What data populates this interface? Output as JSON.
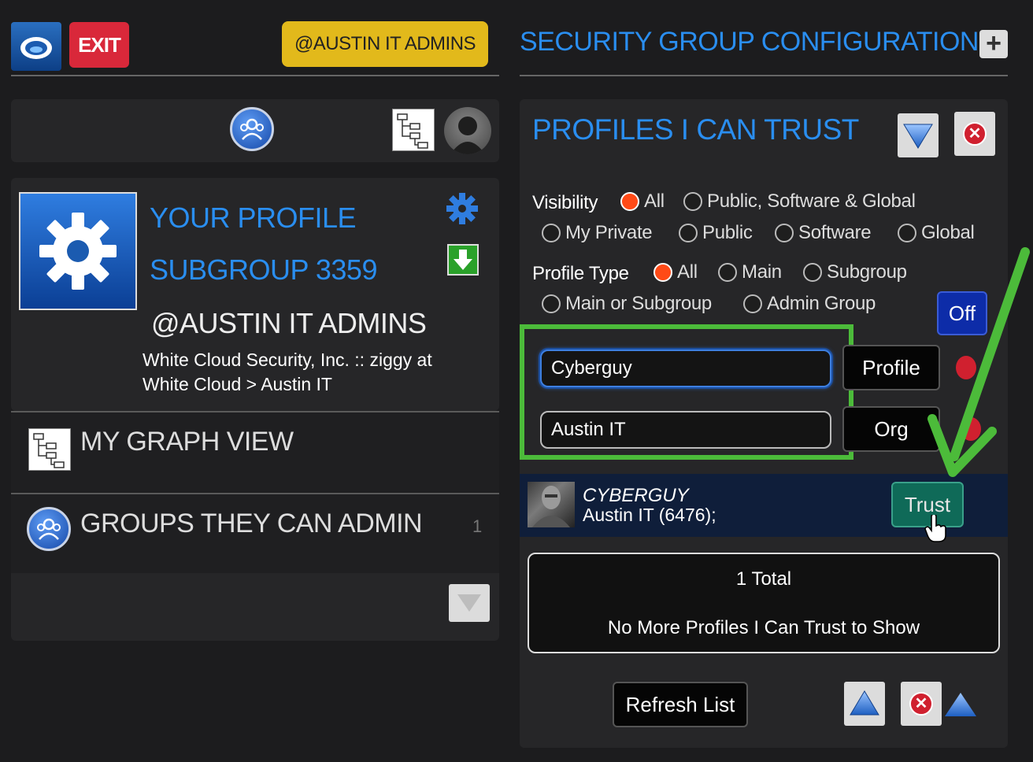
{
  "header": {
    "cloud_icon": "cloud-icon",
    "exit_label": "EXIT",
    "group_chip": "@AUSTIN IT ADMINS",
    "config_title": "SECURITY GROUP CONFIGURATION",
    "plus_label": "+"
  },
  "profile": {
    "title": "YOUR PROFILE",
    "subgroup": "SUBGROUP 3359",
    "handle": "@AUSTIN IT ADMINS",
    "org_line1": "White Cloud Security, Inc. :: ziggy at",
    "org_line2": "White Cloud > Austin IT"
  },
  "menu": {
    "graph_view": "MY GRAPH VIEW",
    "groups_admin": "GROUPS THEY CAN ADMIN",
    "groups_admin_count": "1"
  },
  "trust_panel": {
    "title": "PROFILES I CAN TRUST",
    "visibility_label": "Visibility",
    "visibility_options": [
      "All",
      "Public, Software & Global",
      "My Private",
      "Public",
      "Software",
      "Global"
    ],
    "visibility_selected": "All",
    "profile_type_label": "Profile Type",
    "profile_type_options": [
      "All",
      "Main",
      "Subgroup",
      "Main or Subgroup",
      "Admin Group"
    ],
    "profile_type_selected": "All",
    "off_label": "Off",
    "search_profile_value": "Cyberguy",
    "search_org_value": "Austin IT",
    "profile_button": "Profile",
    "org_button": "Org",
    "result": {
      "name": "CYBERGUY",
      "org": "Austin IT (6476);",
      "trust_button": "Trust"
    },
    "total_text": "1 Total",
    "no_more_text": "No More Profiles I Can Trust to Show",
    "refresh_button": "Refresh List"
  },
  "colors": {
    "accent_blue": "#2a8ef0",
    "exit_red": "#d9283a",
    "chip_yellow": "#e2b91b",
    "annotation_green": "#4cbb3a",
    "trust_green": "#0f6a58"
  }
}
